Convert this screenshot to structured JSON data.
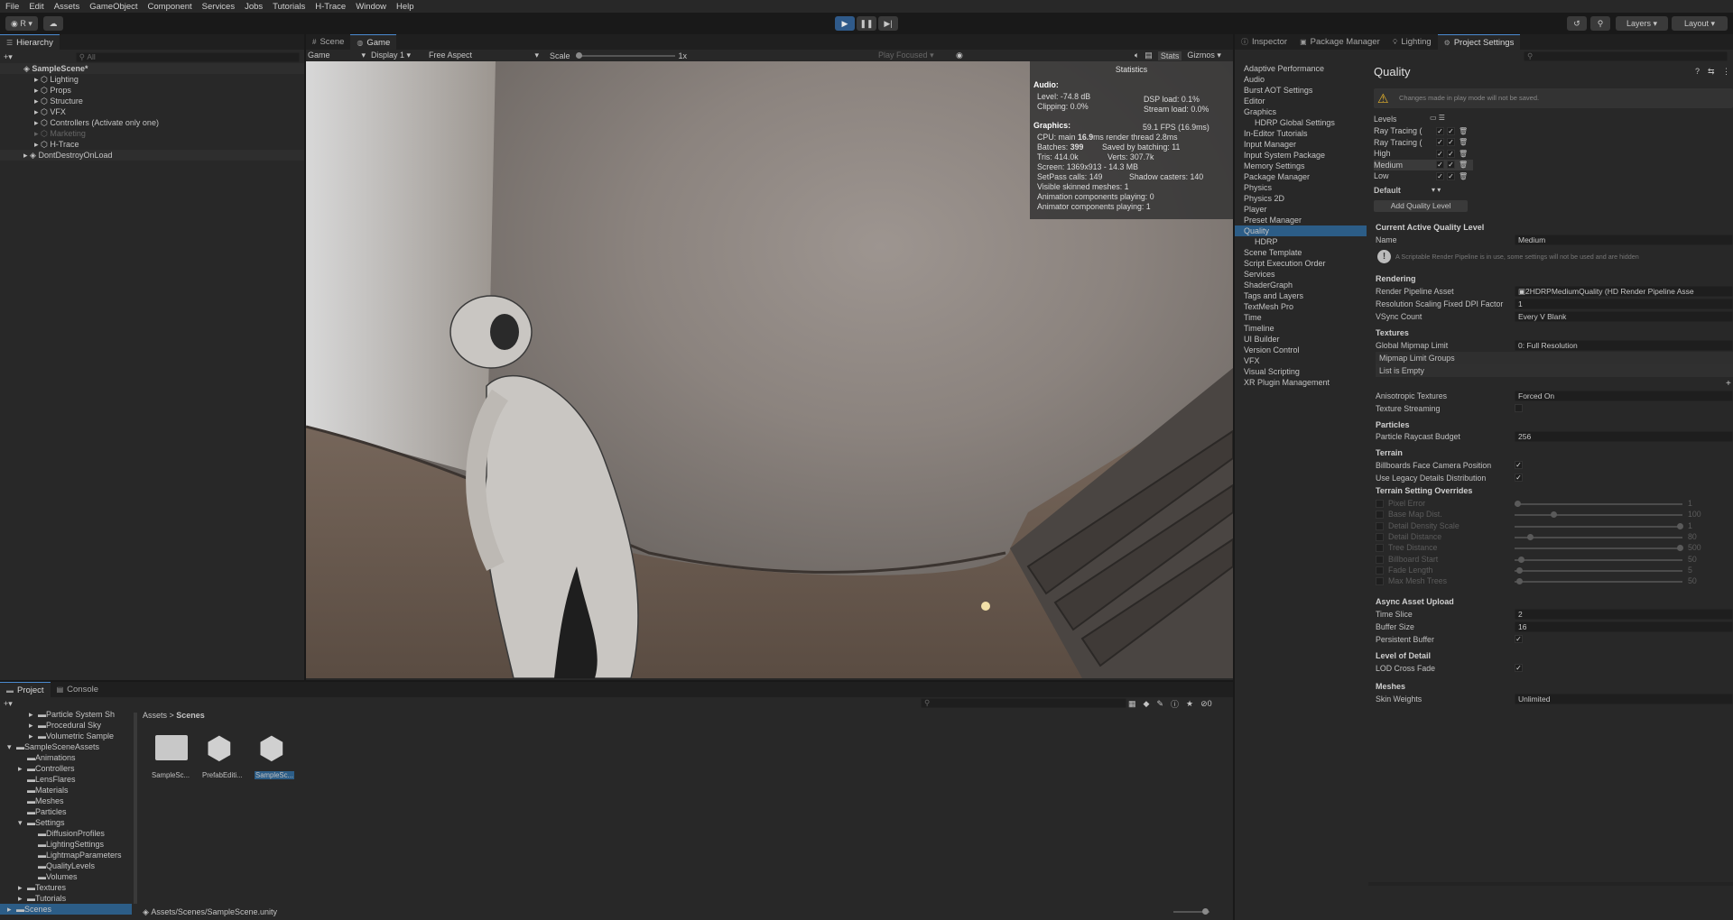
{
  "menubar": [
    "File",
    "Edit",
    "Assets",
    "GameObject",
    "Component",
    "Services",
    "Jobs",
    "Tutorials",
    "H-Trace",
    "Window",
    "Help"
  ],
  "toolbar": {
    "account": "R",
    "layers": "Layers",
    "layout": "Layout"
  },
  "hierarchy": {
    "tab": "Hierarchy",
    "search_placeholder": "All",
    "scene": "SampleScene*",
    "items": [
      "Lighting",
      "Props",
      "Structure",
      "VFX",
      "Controllers (Activate only one)",
      "Marketing",
      "H-Trace"
    ],
    "dont_destroy": "DontDestroyOnLoad"
  },
  "center_tabs": {
    "scene": "Scene",
    "game": "Game"
  },
  "game_toolbar": {
    "view": "Game",
    "display": "Display 1",
    "aspect": "Free Aspect",
    "scale_label": "Scale",
    "scale_value": "1x",
    "play_focused": "Play Focused",
    "stats": "Stats",
    "gizmos": "Gizmos"
  },
  "stats": {
    "title": "Statistics",
    "audio_label": "Audio:",
    "level": "Level: -74.8 dB",
    "clipping": "Clipping: 0.0%",
    "dsp": "DSP load: 0.1%",
    "stream": "Stream load: 0.0%",
    "graphics_label": "Graphics:",
    "fps": "59.1 FPS (16.9ms)",
    "cpu_prefix": "CPU: main ",
    "cpu_main": "16.9",
    "cpu_suffix": "ms  render thread 2.8ms",
    "batches_prefix": "Batches: ",
    "batches": "399",
    "saved": "Saved by batching: 11",
    "tris": "Tris: 414.0k",
    "verts": "Verts: 307.7k",
    "screen": "Screen: 1369x913 - 14.3 MB",
    "setpass": "SetPass calls: 149",
    "shadow": "Shadow casters: 140",
    "skinned": "Visible skinned meshes: 1",
    "anim_comp": "Animation components playing: 0",
    "animator_comp": "Animator components playing: 1"
  },
  "right_tabs": [
    "Inspector",
    "Package Manager",
    "Lighting",
    "Project Settings"
  ],
  "settings_nav": [
    "Adaptive Performance",
    "Audio",
    "Burst AOT Settings",
    "Editor",
    "Graphics",
    "HDRP Global Settings",
    "In-Editor Tutorials",
    "Input Manager",
    "Input System Package",
    "Memory Settings",
    "Package Manager",
    "Physics",
    "Physics 2D",
    "Player",
    "Preset Manager",
    "Quality",
    "HDRP",
    "Scene Template",
    "Script Execution Order",
    "Services",
    "ShaderGraph",
    "Tags and Layers",
    "TextMesh Pro",
    "Time",
    "Timeline",
    "UI Builder",
    "Version Control",
    "VFX",
    "Visual Scripting",
    "XR Plugin Management"
  ],
  "quality": {
    "title": "Quality",
    "warning": "Changes made in play mode will not be saved.",
    "levels_label": "Levels",
    "levels": [
      "Ray Tracing (",
      "Ray Tracing (",
      "High",
      "Medium",
      "Low"
    ],
    "default_label": "Default",
    "add_level": "Add Quality Level",
    "current_header": "Current Active Quality Level",
    "name_label": "Name",
    "name_value": "Medium",
    "srp_info": "A Scriptable Render Pipeline is in use, some settings will not be used and are hidden",
    "rendering": "Rendering",
    "rp_asset_label": "Render Pipeline Asset",
    "rp_asset_value": "2HDRPMediumQuality (HD Render Pipeline Asse",
    "dpi_label": "Resolution Scaling Fixed DPI Factor",
    "dpi_value": "1",
    "vsync_label": "VSync Count",
    "vsync_value": "Every V Blank",
    "textures": "Textures",
    "mip_label": "Global Mipmap Limit",
    "mip_value": "0: Full Resolution",
    "mip_groups": "Mipmap Limit Groups",
    "list_empty": "List is Empty",
    "aniso_label": "Anisotropic Textures",
    "aniso_value": "Forced On",
    "tex_stream": "Texture Streaming",
    "particles": "Particles",
    "raycast_label": "Particle Raycast Budget",
    "raycast_value": "256",
    "terrain": "Terrain",
    "billboards": "Billboards Face Camera Position",
    "legacy_details": "Use Legacy Details Distribution",
    "terrain_overrides": "Terrain Setting Overrides",
    "overrides": [
      {
        "label": "Pixel Error",
        "value": "1",
        "pos": 0.0
      },
      {
        "label": "Base Map Dist.",
        "value": "100",
        "pos": 0.22
      },
      {
        "label": "Detail Density Scale",
        "value": "1",
        "pos": 1.0
      },
      {
        "label": "Detail Distance",
        "value": "80",
        "pos": 0.08
      },
      {
        "label": "Tree Distance",
        "value": "500",
        "pos": 1.0
      },
      {
        "label": "Billboard Start",
        "value": "50",
        "pos": 0.02
      },
      {
        "label": "Fade Length",
        "value": "5",
        "pos": 0.01
      },
      {
        "label": "Max Mesh Trees",
        "value": "50",
        "pos": 0.01
      }
    ],
    "async": "Async Asset Upload",
    "time_slice_label": "Time Slice",
    "time_slice_value": "2",
    "buffer_label": "Buffer Size",
    "buffer_value": "16",
    "persistent_label": "Persistent Buffer",
    "lod": "Level of Detail",
    "lod_cross": "LOD Cross Fade",
    "meshes": "Meshes",
    "skin_label": "Skin Weights",
    "skin_value": "Unlimited"
  },
  "project": {
    "tabs": [
      "Project",
      "Console"
    ],
    "tree": [
      "Particle System Sh",
      "Procedural Sky",
      "Volumetric Sample",
      "SampleSceneAssets",
      "Animations",
      "Controllers",
      "LensFlares",
      "Materials",
      "Meshes",
      "Particles",
      "Settings",
      "DiffusionProfiles",
      "LightingSettings",
      "LightmapParameters",
      "QualityLevels",
      "Volumes",
      "Textures",
      "Tutorials",
      "Scenes"
    ],
    "breadcrumb": [
      "Assets",
      "Scenes"
    ],
    "assets": [
      "SampleSc...",
      "PrefabEditi...",
      "SampleSc..."
    ],
    "path": "Assets/Scenes/SampleScene.unity",
    "hidden_count": "0"
  }
}
